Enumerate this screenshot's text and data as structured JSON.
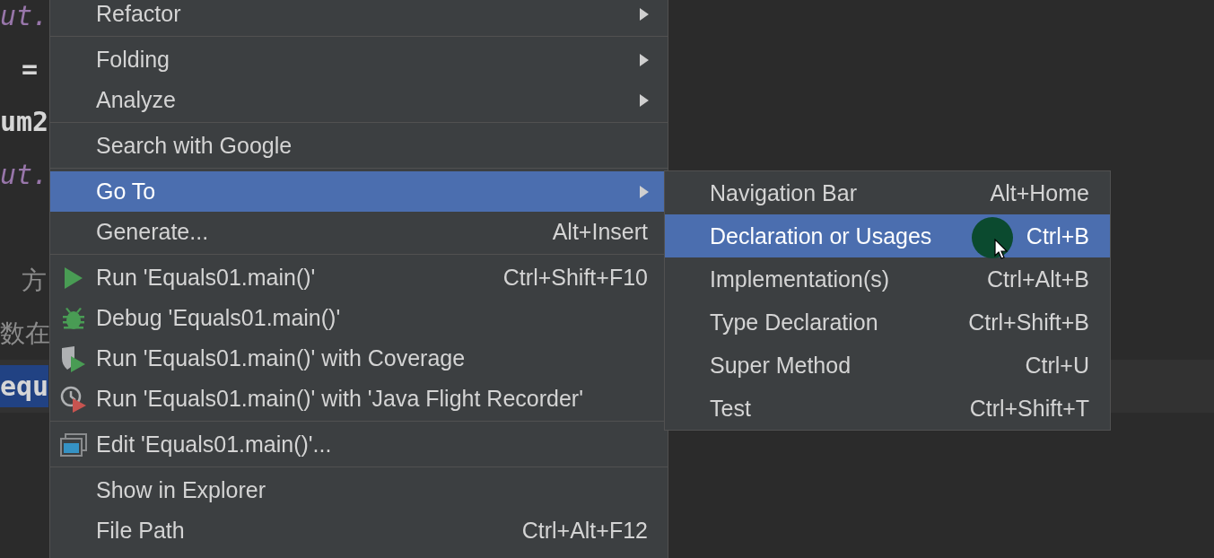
{
  "editor": {
    "lines": [
      {
        "kind": "field",
        "text": "ut.",
        "indent": false
      },
      {
        "kind": "code",
        "text": "=",
        "indent": true
      },
      {
        "kind": "code",
        "text": "um2",
        "indent": false
      },
      {
        "kind": "field",
        "text": "ut.",
        "indent": false
      },
      {
        "kind": "blank"
      },
      {
        "kind": "comment",
        "text": "方",
        "indent": true
      },
      {
        "kind": "comment",
        "text": "数在",
        "indent": false
      },
      {
        "kind": "selected",
        "text": "equ",
        "indent": false
      }
    ]
  },
  "context_menu": {
    "groups": [
      [
        {
          "label": "Refactor",
          "submenu": true,
          "selected": false
        }
      ],
      [
        {
          "label": "Folding",
          "submenu": true,
          "selected": false
        },
        {
          "label": "Analyze",
          "submenu": true,
          "selected": false
        }
      ],
      [
        {
          "label": "Search with Google",
          "submenu": false,
          "selected": false
        }
      ],
      [
        {
          "label": "Go To",
          "submenu": true,
          "selected": true
        },
        {
          "label": "Generate...",
          "shortcut": "Alt+Insert",
          "submenu": false,
          "selected": false
        }
      ],
      [
        {
          "label": "Run 'Equals01.main()'",
          "shortcut": "Ctrl+Shift+F10",
          "kind": "run",
          "submenu": false,
          "selected": false
        },
        {
          "label": "Debug 'Equals01.main()'",
          "kind": "debug",
          "submenu": false,
          "selected": false
        },
        {
          "label": "Run 'Equals01.main()' with Coverage",
          "kind": "coverage",
          "submenu": false,
          "selected": false
        },
        {
          "label": "Run 'Equals01.main()' with 'Java Flight Recorder'",
          "kind": "profiler",
          "submenu": false,
          "selected": false
        }
      ],
      [
        {
          "label": "Edit 'Equals01.main()'...",
          "kind": "edit",
          "submenu": false,
          "selected": false
        }
      ],
      [
        {
          "label": "Show in Explorer",
          "submenu": false,
          "selected": false
        },
        {
          "label": "File Path",
          "shortcut": "Ctrl+Alt+F12",
          "submenu": false,
          "selected": false
        }
      ]
    ]
  },
  "submenu": {
    "items": [
      {
        "label": "Navigation Bar",
        "shortcut": "Alt+Home",
        "selected": false
      },
      {
        "label": "Declaration or Usages",
        "shortcut": "Ctrl+B",
        "selected": true
      },
      {
        "label": "Implementation(s)",
        "shortcut": "Ctrl+Alt+B",
        "selected": false
      },
      {
        "label": "Type Declaration",
        "shortcut": "Ctrl+Shift+B",
        "selected": false
      },
      {
        "label": "Super Method",
        "shortcut": "Ctrl+U",
        "selected": false
      },
      {
        "label": "Test",
        "shortcut": "Ctrl+Shift+T",
        "selected": false
      }
    ]
  }
}
